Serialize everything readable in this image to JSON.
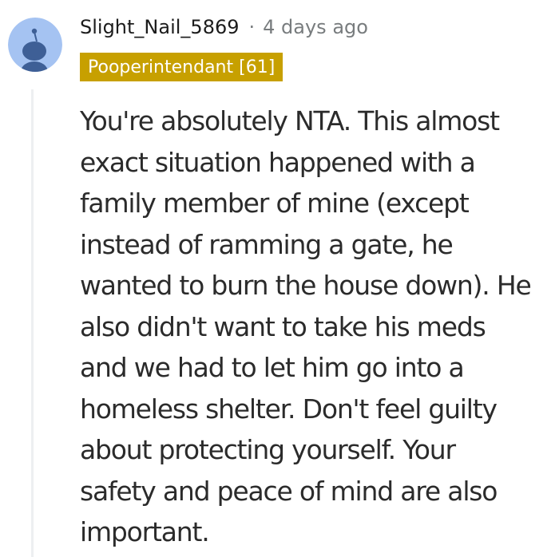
{
  "comment": {
    "username": "Slight_Nail_5869",
    "separator": "·",
    "timestamp": "4 days ago",
    "flair": "Pooperintendant [61]",
    "avatar_icon": "reddit-snoo-avatar-icon",
    "body_lines": [
      "You're absolutely NTA. This almost",
      "exact situation happened with a",
      "family member of mine (except",
      "instead of ramming a gate, he",
      "wanted to burn the house down). He",
      "also didn't want to take his meds",
      "and we had to let him go into a",
      "homeless shelter. Don't feel guilty",
      "about protecting yourself. Your",
      "safety and peace of mind are also",
      "important."
    ]
  },
  "colors": {
    "avatar_background": "#a5c3f2",
    "avatar_figure": "#3e5f96",
    "flair_background": "#c7a000",
    "flair_text": "#ffffff",
    "meta_text": "#787c7e",
    "thread_line": "#edeff1"
  }
}
